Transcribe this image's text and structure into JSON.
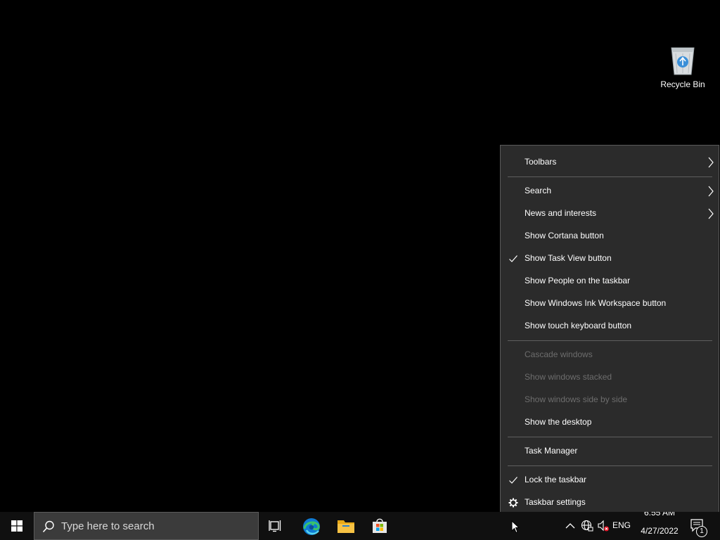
{
  "desktop": {
    "recycle_bin_label": "Recycle Bin"
  },
  "context_menu": {
    "items": [
      {
        "label": "Toolbars",
        "submenu": true
      },
      {
        "label": "Search",
        "submenu": true
      },
      {
        "label": "News and interests",
        "submenu": true
      },
      {
        "label": "Show Cortana button"
      },
      {
        "label": "Show Task View button",
        "checked": true
      },
      {
        "label": "Show People on the taskbar"
      },
      {
        "label": "Show Windows Ink Workspace button"
      },
      {
        "label": "Show touch keyboard button"
      },
      {
        "label": "Cascade windows",
        "disabled": true
      },
      {
        "label": "Show windows stacked",
        "disabled": true
      },
      {
        "label": "Show windows side by side",
        "disabled": true
      },
      {
        "label": "Show the desktop"
      },
      {
        "label": "Task Manager"
      },
      {
        "label": "Lock the taskbar",
        "checked": true
      },
      {
        "label": "Taskbar settings",
        "icon": "gear-icon"
      }
    ]
  },
  "taskbar": {
    "search_placeholder": "Type here to search",
    "pinned_apps": [
      "task-view-icon",
      "edge-icon",
      "file-explorer-icon",
      "store-icon"
    ],
    "tray": {
      "language": "ENG",
      "time": "6:55 AM",
      "date": "4/27/2022",
      "notification_count": "1"
    }
  },
  "colors": {
    "menu_bg": "#2b2b2b",
    "menu_text": "#ffffff",
    "menu_disabled_text": "#6d6d6d",
    "taskbar_bg": "#101010",
    "search_bg": "#3b3b3b",
    "edge_blue": "#0f7bd4",
    "edge_green": "#39c26b",
    "explorer_yellow": "#f7c244"
  }
}
